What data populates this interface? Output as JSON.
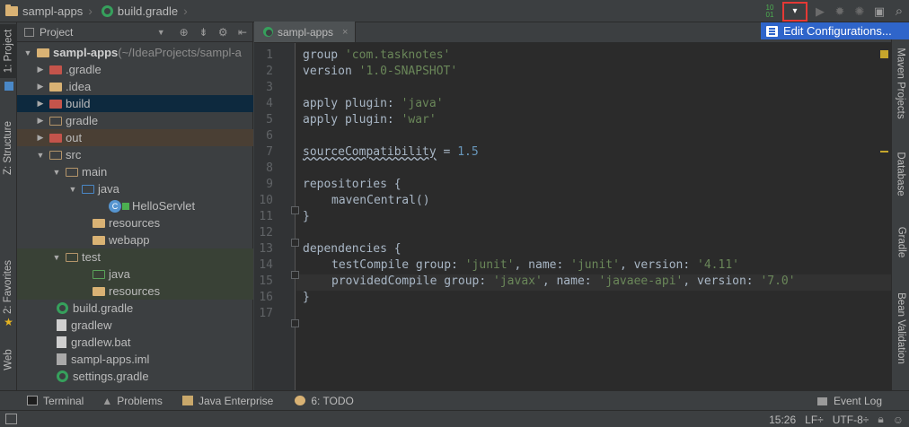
{
  "breadcrumb": {
    "project": "sampl-apps",
    "file": "build.gradle"
  },
  "toolbar": {
    "dropdown_glyph": "▾",
    "run": "▶",
    "debug": "✹",
    "coverage": "✺",
    "structure": "▣",
    "search": "⌕"
  },
  "popup": {
    "label": "Edit Configurations..."
  },
  "left_tabs": {
    "project": "1: Project",
    "structure": "Z: Structure",
    "favorites": "2: Favorites",
    "web": "Web"
  },
  "right_tabs": {
    "maven": "Maven Projects",
    "database": "Database",
    "gradle": "Gradle",
    "bean": "Bean Validation"
  },
  "project_panel": {
    "view": "Project"
  },
  "tree": [
    {
      "label": "sampl-apps",
      "suffix": " (~/IdeaProjects/sampl-a"
    },
    {
      "label": ".gradle"
    },
    {
      "label": ".idea"
    },
    {
      "label": "build"
    },
    {
      "label": "gradle"
    },
    {
      "label": "out"
    },
    {
      "label": "src"
    },
    {
      "label": "main"
    },
    {
      "label": "java"
    },
    {
      "label": "HelloServlet"
    },
    {
      "label": "resources"
    },
    {
      "label": "webapp"
    },
    {
      "label": "test"
    },
    {
      "label": "java"
    },
    {
      "label": "resources"
    },
    {
      "label": "build.gradle"
    },
    {
      "label": "gradlew"
    },
    {
      "label": "gradlew.bat"
    },
    {
      "label": "sampl-apps.iml"
    },
    {
      "label": "settings.gradle"
    }
  ],
  "editor": {
    "tab_label": "sampl-apps",
    "close": "×"
  },
  "line_numbers": [
    "1",
    "2",
    "3",
    "4",
    "5",
    "6",
    "7",
    "8",
    "9",
    "10",
    "11",
    "12",
    "13",
    "14",
    "15",
    "16",
    "17"
  ],
  "code": {
    "l1a": "group ",
    "l1b": "'com.tasknotes'",
    "l2a": "version ",
    "l2b": "'1.0-SNAPSHOT'",
    "l4a": "apply plugin: ",
    "l4b": "'java'",
    "l5a": "apply plugin: ",
    "l5b": "'war'",
    "l7a": "sourceCompatibility",
    "l7b": " = ",
    "l7c": "1.5",
    "l9": "repositories {",
    "l10": "mavenCentral()",
    "l11": "}",
    "l13": "dependencies {",
    "l14a": "testCompile group: ",
    "l14b": "'junit'",
    "l14c": ", name: ",
    "l14d": "'junit'",
    "l14e": ", version: ",
    "l14f": "'4.11'",
    "l15a": "providedCompile group: ",
    "l15b": "'javax'",
    "l15c": ", name: ",
    "l15d": "'javaee-api'",
    "l15e": ", version: ",
    "l15f": "'7.0'",
    "l16": "}"
  },
  "bottom_tabs": {
    "terminal": "Terminal",
    "problems": "Problems",
    "java_enterprise": "Java Enterprise",
    "todo": "6: TODO",
    "event_log": "Event Log"
  },
  "status": {
    "position": "15:26",
    "line_sep": "LF÷",
    "encoding": "UTF-8÷"
  }
}
